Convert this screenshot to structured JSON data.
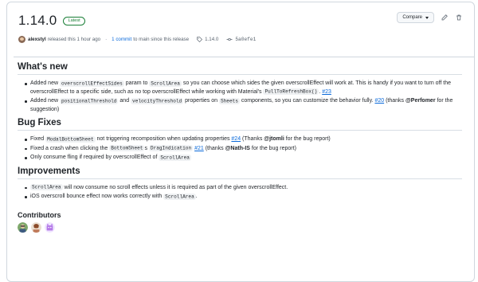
{
  "release": {
    "title": "1.14.0",
    "badge": "Latest",
    "author": "alexstyl",
    "released_text": "released this 1 hour ago",
    "commits_link": "1 commit",
    "commits_suffix": "to main since this release",
    "tag": "1.14.0",
    "commit_sha": "5a0efe1"
  },
  "actions": {
    "compare_label": "Compare"
  },
  "sections": {
    "whats_new": {
      "title": "What's new",
      "item1": {
        "t1": "Added new ",
        "c1": "overscrollEffectSides",
        "t2": " param to ",
        "c2": "ScrollArea",
        "t3": " so you can choose which sides the given overscrollEffect will work at. This is handy if you want to turn off the overscrollEffect to a specific side, such as no top overscrollEffect while working with Material's ",
        "c3": "PullToRefreshBox()",
        "t4": ". ",
        "ref": "#23"
      },
      "item2": {
        "t1": "Added new ",
        "c1": "positionalThreshold",
        "t2": " and ",
        "c2": "velocityThreshold",
        "t3": " properties on ",
        "c3": "Sheets",
        "t4": " components, so you can customize the behavior fully. ",
        "ref": "#20",
        "t5": " (thanks ",
        "mention": "@Perfomer",
        "t6": " for the suggestion)"
      }
    },
    "bug_fixes": {
      "title": "Bug Fixes",
      "item1": {
        "t1": "Fixed ",
        "c1": "ModalBottomSheet",
        "t2": " not triggering recomposition when updating properties ",
        "ref": "#24",
        "t3": " (Thanks ",
        "mention": "@jtomli",
        "t4": " for the bug report)"
      },
      "item2": {
        "t1": "Fixed a crash when clicking the ",
        "c1": "BottomSheet",
        "t2": "s ",
        "c2": "DragIndication",
        "t3": " ",
        "ref": "#21",
        "t4": " (thanks ",
        "mention": "@Nath-IS",
        "t5": " for the bug report)"
      },
      "item3": {
        "t1": "Only consume fling if required by overscrollEffect of ",
        "c1": "ScrollArea"
      }
    },
    "improvements": {
      "title": "Improvements",
      "item1": {
        "c1": "ScrollArea",
        "t1": " will now consume no scroll effects unless it is required as part of the given overscrollEffect."
      },
      "item2": {
        "t1": "iOS overscroll bounce effect now works correctly with ",
        "c1": "ScrollArea",
        "t2": "."
      }
    },
    "contributors": {
      "title": "Contributors"
    }
  },
  "colors": {
    "link": "#0969da",
    "badge_green": "#1a7f37",
    "border": "#d0d7de"
  },
  "icons": [
    "pencil-icon",
    "trash-icon",
    "tag-icon",
    "commit-icon",
    "caret-down-icon"
  ]
}
